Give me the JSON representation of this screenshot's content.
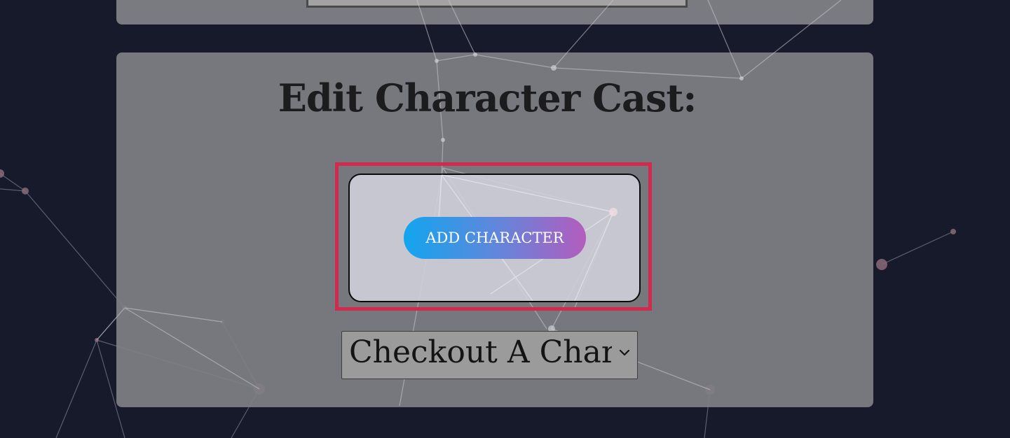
{
  "panel": {
    "title": "Edit Character Cast:"
  },
  "add_character": {
    "label": "ADD CHARACTER"
  },
  "character_select": {
    "selected": "Checkout A Character"
  },
  "colors": {
    "background": "#161a2a",
    "panel": "#7f7f86",
    "highlight": "#d12a4c",
    "button_gradient_start": "#12a5ef",
    "button_gradient_end": "#b45cbe"
  }
}
